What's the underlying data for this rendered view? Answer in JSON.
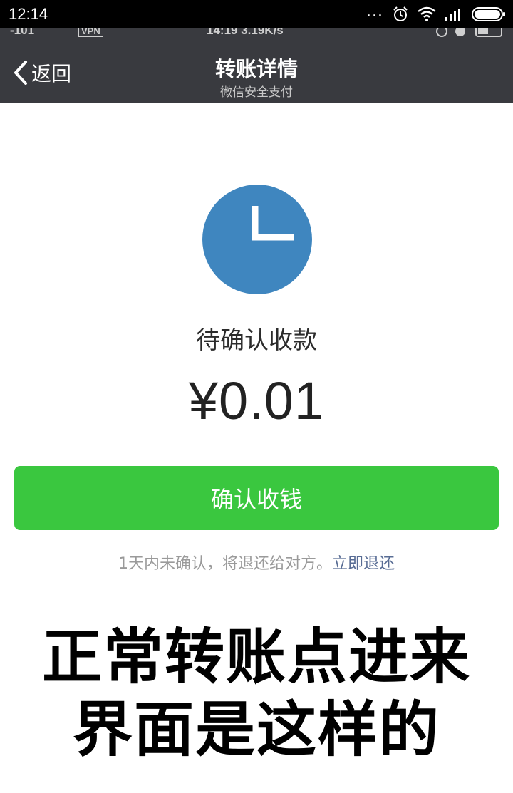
{
  "status_bar": {
    "time": "12:14",
    "dots": "...",
    "icons": [
      "alarm-icon",
      "wifi-icon",
      "signal-icon",
      "battery-icon"
    ]
  },
  "embedded_status": {
    "left": "-101",
    "vpn": "VPN",
    "center": "14:19 3.19K/s"
  },
  "nav": {
    "back_label": "返回",
    "title": "转账详情",
    "subtitle": "微信安全支付",
    "background": "#393a3f"
  },
  "transfer": {
    "status_label": "待确认收款",
    "amount": "¥0.01",
    "confirm_button": "确认收钱",
    "notice_text": "1天内未确认，将退还给对方。",
    "refund_link": "立即退还",
    "icon": "clock-icon",
    "accent_blue": "#3f86bf",
    "accent_green": "#3ac73f"
  },
  "caption": {
    "line1": "正常转账点进来",
    "line2": "界面是这样的"
  }
}
